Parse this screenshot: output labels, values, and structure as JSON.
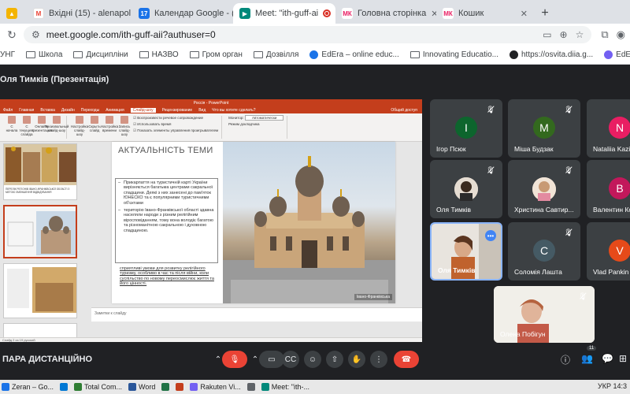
{
  "browser": {
    "tabs": [
      {
        "label": "",
        "icon": "yellow-app-icon",
        "color": "#f4b400"
      },
      {
        "label": "Вхідні (15) - alenapol",
        "icon": "gmail-icon",
        "color": "#ea4335"
      },
      {
        "label": "Календар Google - (",
        "icon": "calendar-icon",
        "color": "#1a73e8",
        "badge": "17"
      },
      {
        "label": "Meet: \"ith-guff-ai",
        "icon": "meet-icon",
        "color": "#00897b",
        "active": true
      },
      {
        "label": "Головна сторінка",
        "icon": "mk-icon",
        "color": "#e91e63",
        "badge": "МК"
      },
      {
        "label": "Кошик",
        "icon": "mk-icon",
        "color": "#e91e63",
        "badge": "МК"
      }
    ],
    "new_tab": "+",
    "url": "meet.google.com/ith-guff-aii?authuser=0",
    "bookmarks": [
      {
        "label": "УНГ",
        "type": "text"
      },
      {
        "label": "Школа",
        "type": "folder"
      },
      {
        "label": "Дисципліни",
        "type": "folder"
      },
      {
        "label": "НАЗВО",
        "type": "folder"
      },
      {
        "label": "Гром орган",
        "type": "folder"
      },
      {
        "label": "Дозвілля",
        "type": "folder"
      },
      {
        "label": "EdEra – online educ...",
        "type": "site",
        "color": "#1a73e8"
      },
      {
        "label": "Innovating Educatio...",
        "type": "site",
        "color": "#5f6368"
      },
      {
        "label": "https://osvita.diia.g...",
        "type": "site",
        "color": "#202124"
      },
      {
        "label": "EdEra у Viber",
        "type": "site",
        "color": "#7360f2"
      }
    ]
  },
  "meet": {
    "presenter_label": "Оля Тимків (Презентація)",
    "meeting_name": "ПАРА ДИСТАНЦІЙНО",
    "participant_count": "11",
    "tiles": [
      {
        "name": "Ігор Псюк",
        "initial": "I",
        "color": "#0d652d"
      },
      {
        "name": "Міша Будзак",
        "initial": "M",
        "color": "#33691e"
      },
      {
        "name": "Nataliia Kazin",
        "initial": "N",
        "color": "#e91e63"
      },
      {
        "name": "Оля Тимків",
        "photo": true
      },
      {
        "name": "Христина Савтир...",
        "photo": true
      },
      {
        "name": "Валентин Ко",
        "initial": "B",
        "color": "#c2185b"
      },
      {
        "name": "Оля Тимків",
        "photo": true,
        "active": true
      },
      {
        "name": "Соломія Лашта",
        "initial": "C",
        "color": "#455a64"
      },
      {
        "name": "Vlad Pankin",
        "initial": "V",
        "color": "#e64a19"
      }
    ],
    "self_view_name": "Олена Побігун"
  },
  "powerpoint": {
    "title": "Россія - PowerPoint",
    "tabs": [
      "Файл",
      "Главная",
      "Вставка",
      "Дизайн",
      "Переходы",
      "Анимация",
      "Слайд-шоу",
      "Рецензирование",
      "Вид",
      "Что вы хотите сделать?"
    ],
    "active_tab": "Слайд-шоу",
    "share_label": "Общий доступ",
    "ribbon": {
      "buttons": [
        "С начала",
        "С текущего слайда",
        "Онлайн-презентация",
        "Произвольный слайд-шоу",
        "Настройка слайд-шоу",
        "Скрыть слайд",
        "Настройка времени",
        "Запись слайд-шоу"
      ],
      "checks": [
        "Воспроизвести речевое сопровождение",
        "Использовать время",
        "Показать элементы управления проигрывателем"
      ],
      "monitor_label": "Монитор:",
      "monitor_value": "Автоматически",
      "presenter_view": "Режим докладчика",
      "group_labels": [
        "Начать слайд-шоу",
        "Настройка",
        "Мониторы"
      ]
    },
    "thumbs_caption": "ПЕРЕЛІК РЕГІОНІВ ІВАНО-ФРАНКІВСЬКОЇ ОБЛАСТІ З МЕТОЮ ЗМЕНШЕННЯ ВІДВІДУВАННЯ",
    "slide": {
      "title": "АКТУАЛЬНІСТЬ ТЕМИ",
      "bullets": [
        "Прикарпаття на туристичній карті України вирізняється багатьма центрами сакральної спадщини. Деякі з них занесені до пам'яток ЮНЕСКО та є популярними туристичними об'єктами",
        "територію Івано-Франківської області здавна населяли народи з різним релігійним віросповіданням, тому вона володіє багатою та різноманітною сакральною і духовною спадщиною."
      ],
      "footer_link": "сприятливі умови для розвитку релігійного туризму,",
      "footer_rest": " особливо в час та після війни, коли суспільство по новому переосмислює життя та його цінності.",
      "photo_caption": "Івано-Франківська"
    },
    "notes_placeholder": "Заметки к слайду",
    "status": "Слайд 2 из 19   русский"
  },
  "taskbar": {
    "items": [
      {
        "label": "Zeran – Go...",
        "color": "#1a73e8"
      },
      {
        "label": "",
        "color": "#0078d4"
      },
      {
        "label": "Total Com...",
        "color": "#2e7d32"
      },
      {
        "label": "Word",
        "color": "#2b579a"
      },
      {
        "label": "",
        "color": "#217346"
      },
      {
        "label": "",
        "color": "#c43e1c"
      },
      {
        "label": "Rakuten Vi...",
        "color": "#7360f2"
      },
      {
        "label": "",
        "color": "#5f6368"
      },
      {
        "label": "Meet: \"ith-...",
        "color": "#00897b"
      }
    ],
    "lang": "УКР",
    "time": "14:3"
  }
}
